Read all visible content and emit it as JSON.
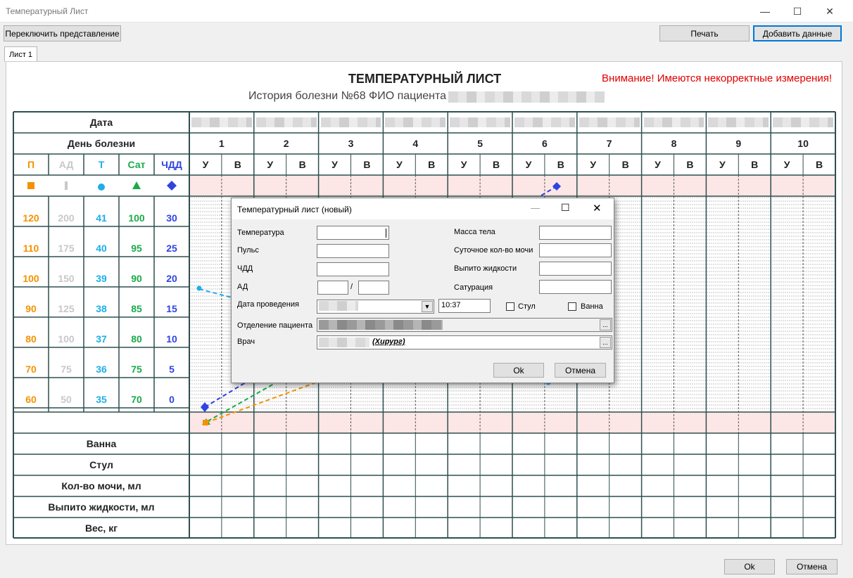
{
  "window": {
    "title": "Температурный Лист"
  },
  "toolbar": {
    "switch_view": "Переключить представление",
    "print": "Печать",
    "add_data": "Добавить данные"
  },
  "tabs": [
    "Лист 1"
  ],
  "sheet": {
    "title": "ТЕМПЕРАТУРНЫЙ ЛИСТ",
    "warning": "Внимание! Имеются некорректные измерения!",
    "subtitle": "История болезни №68 ФИО пациента",
    "row_labels": {
      "date": "Дата",
      "illness_day": "День болезни",
      "bath": "Ванна",
      "stool": "Стул",
      "urine": "Кол-во мочи, мл",
      "fluid": "Выпито жидкости, мл",
      "weight": "Вес, кг"
    },
    "day_numbers": [
      "1",
      "2",
      "3",
      "4",
      "5",
      "6",
      "7",
      "8",
      "9",
      "10"
    ],
    "morning": "У",
    "evening": "В",
    "legend": [
      {
        "key": "П",
        "color": "#f39200",
        "marker": "square"
      },
      {
        "key": "АД",
        "color": "#c8c8c8",
        "marker": "bar"
      },
      {
        "key": "Т",
        "color": "#1eaee8",
        "marker": "circle"
      },
      {
        "key": "Сат",
        "color": "#1aab4a",
        "marker": "triangle"
      },
      {
        "key": "ЧДД",
        "color": "#2f44e0",
        "marker": "diamond"
      }
    ],
    "scales": [
      [
        "120",
        "200",
        "41",
        "100",
        "30"
      ],
      [
        "110",
        "175",
        "40",
        "95",
        "25"
      ],
      [
        "100",
        "150",
        "39",
        "90",
        "20"
      ],
      [
        "90",
        "125",
        "38",
        "85",
        "15"
      ],
      [
        "80",
        "100",
        "37",
        "80",
        "10"
      ],
      [
        "70",
        "75",
        "36",
        "75",
        "5"
      ],
      [
        "60",
        "50",
        "35",
        "70",
        "0"
      ]
    ]
  },
  "dialog": {
    "title": "Температурный лист (новый)",
    "labels": {
      "temp": "Температура",
      "pulse": "Пульс",
      "rr": "ЧДД",
      "bp": "АД",
      "date": "Дата проведения",
      "dept": "Отделение пациента",
      "doctor": "Врач",
      "mass": "Масса тела",
      "urine": "Суточное кол-во мочи",
      "fluid": "Выпито жидкости",
      "sat": "Сатурация",
      "stool": "Стул",
      "bath": "Ванна"
    },
    "values": {
      "time": "10:37",
      "doctor_suffix": "(Хирург)",
      "bp_sep": "/"
    },
    "ok": "Ok",
    "cancel": "Отмена"
  },
  "footer": {
    "ok": "Ok",
    "cancel": "Отмена"
  },
  "icons": {
    "minimize": "minimize-icon",
    "maximize": "maximize-icon",
    "close": "close-icon"
  }
}
